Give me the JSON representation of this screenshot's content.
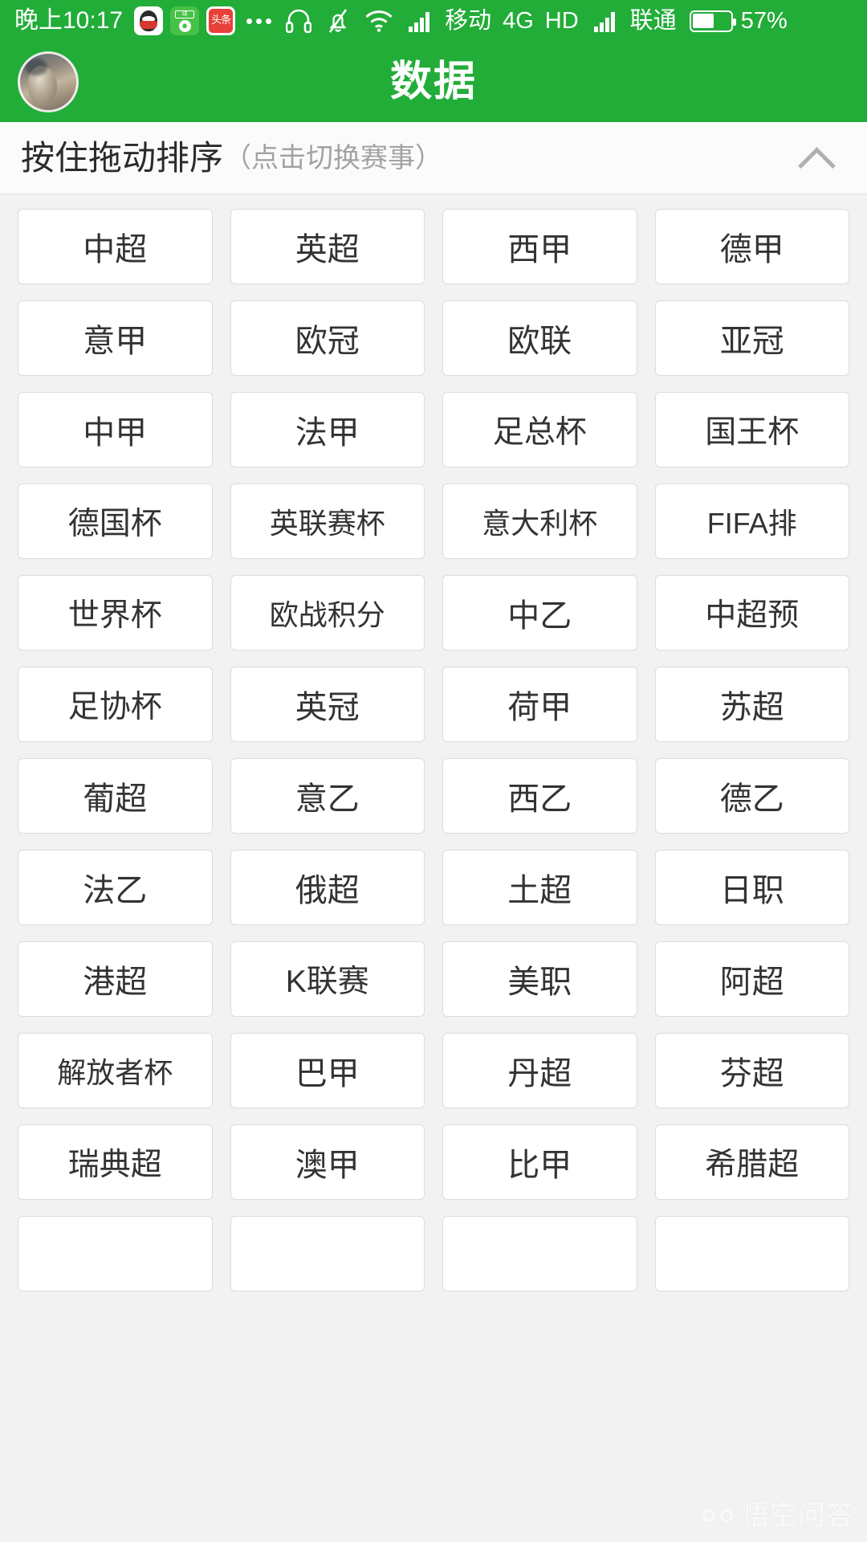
{
  "status_bar": {
    "time": "晚上10:17",
    "app_icons": [
      {
        "name": "qq-app-icon",
        "label": "QQ"
      },
      {
        "name": "soccer-app-icon",
        "label": "球"
      },
      {
        "name": "toutiao-app-icon",
        "label": "头条"
      }
    ],
    "overflow_dots": "•••",
    "headset_icon": "headset-icon",
    "mute_bell_icon": "bell-muted-icon",
    "wifi_icon": "wifi-icon",
    "signal_icon_1": "signal-bars-icon",
    "carrier_1": "移动",
    "network_type": "4G",
    "hd_label": "HD",
    "signal_icon_2": "signal-bars-icon",
    "carrier_2": "联通",
    "battery_percent": "57%",
    "battery_level": 57,
    "bar_color": "#22ac38"
  },
  "header": {
    "title": "数据",
    "avatar_name": "user-avatar",
    "bg_color": "#22ac38"
  },
  "section_bar": {
    "title": "按住拖动排序",
    "hint": "（点击切换赛事）",
    "collapse_icon": "chevron-up-icon"
  },
  "grid": {
    "columns": 4,
    "tiles": [
      "中超",
      "英超",
      "西甲",
      "德甲",
      "意甲",
      "欧冠",
      "欧联",
      "亚冠",
      "中甲",
      "法甲",
      "足总杯",
      "国王杯",
      "德国杯",
      "英联赛杯",
      "意大利杯",
      "FIFA排",
      "世界杯",
      "欧战积分",
      "中乙",
      "中超预",
      "足协杯",
      "英冠",
      "荷甲",
      "苏超",
      "葡超",
      "意乙",
      "西乙",
      "德乙",
      "法乙",
      "俄超",
      "土超",
      "日职",
      "港超",
      "K联赛",
      "美职",
      "阿超",
      "解放者杯",
      "巴甲",
      "丹超",
      "芬超",
      "瑞典超",
      "澳甲",
      "比甲",
      "希腊超",
      "",
      "",
      "",
      ""
    ]
  },
  "watermark": {
    "text": "悟空问答",
    "logo_name": "wukong-logo-icon"
  }
}
